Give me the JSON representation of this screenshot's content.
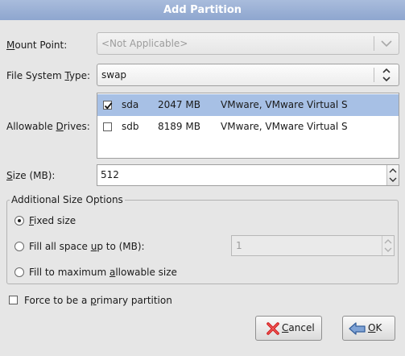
{
  "window": {
    "title": "Add Partition"
  },
  "mount_point": {
    "label": "Mount Point:",
    "value": "<Not Applicable>"
  },
  "fs_type": {
    "label": "File System Type:",
    "value": "swap"
  },
  "drives": {
    "label": "Allowable Drives:",
    "rows": [
      {
        "checked": true,
        "name": "sda",
        "size": "2047 MB",
        "model": "VMware, VMware Virtual S"
      },
      {
        "checked": false,
        "name": "sdb",
        "size": "8189 MB",
        "model": "VMware, VMware Virtual S"
      }
    ]
  },
  "size": {
    "label": "Size (MB):",
    "value": "512"
  },
  "additional": {
    "title": "Additional Size Options",
    "fixed_label": "Fixed size",
    "fill_upto_label": "Fill all space up to (MB):",
    "fill_upto_value": "1",
    "fill_max_label": "Fill to maximum allowable size",
    "selected": "fixed"
  },
  "force_primary": {
    "label": "Force to be a primary partition",
    "checked": false
  },
  "buttons": {
    "cancel": "Cancel",
    "ok": "OK"
  },
  "icons": {
    "cancel": "red-x-icon",
    "ok": "back-arrow-icon",
    "check": "check-icon"
  }
}
